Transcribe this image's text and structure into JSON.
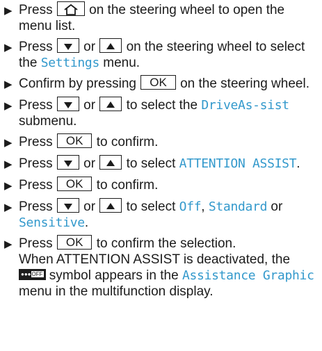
{
  "colors": {
    "text": "#1c1c1c",
    "menu_highlight": "#3399cc"
  },
  "icons": {
    "bullet": "triangle-right-icon",
    "home": "home-icon",
    "down": "arrow-down-icon",
    "up": "arrow-up-icon",
    "attention": "attention-assist-off-icon"
  },
  "keys": {
    "ok": "OK",
    "off_badge": "OFF"
  },
  "steps": [
    {
      "pre": "Press",
      "post": "on the steering wheel to open the menu list."
    },
    {
      "pre": "Press",
      "or": "or",
      "post": "on the steering wheel to select the",
      "menu": "Settings",
      "tail": "menu."
    },
    {
      "pre": "Confirm by pressing",
      "post": "on the steering wheel."
    },
    {
      "pre": "Press",
      "or": "or",
      "post": "to select the",
      "menu": "DriveAs-sist",
      "tail": "submenu."
    },
    {
      "pre": "Press",
      "post": "to confirm."
    },
    {
      "pre": "Press",
      "or": "or",
      "post": "to select",
      "menu": "ATTENTION ASSIST",
      "tail": "."
    },
    {
      "pre": "Press",
      "post": "to confirm."
    },
    {
      "pre": "Press",
      "or": "or",
      "post": "to select",
      "menu1": "Off",
      "sep1": ",",
      "menu2": "Standard",
      "sep2": "or",
      "menu3": "Sensitive",
      "tail": "."
    },
    {
      "pre": "Press",
      "post": "to confirm the selection.",
      "note_pre": "When ATTENTION ASSIST is deactivated, the",
      "note_mid": "symbol appears in the",
      "menu": "Assistance Graphic",
      "note_post": "menu in the multifunction display."
    }
  ]
}
